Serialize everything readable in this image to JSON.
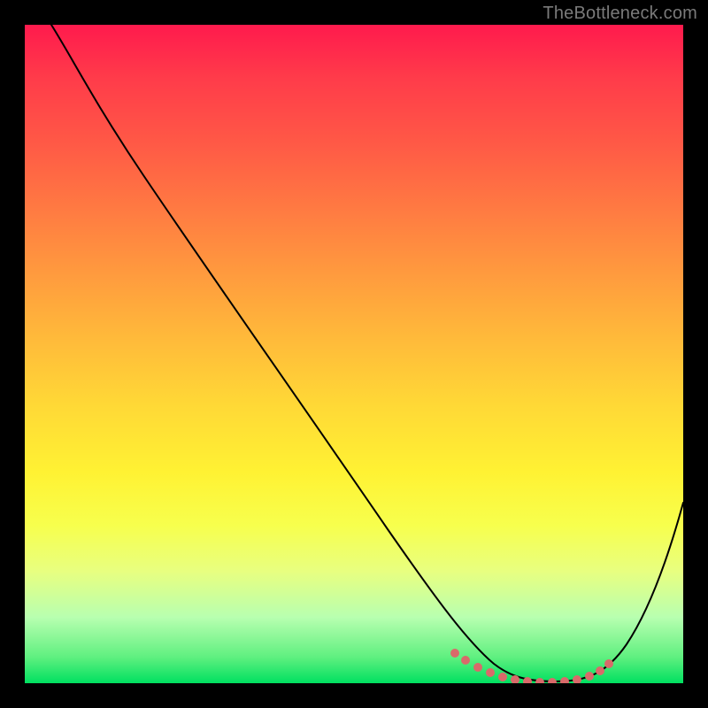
{
  "watermark": "TheBottleneck.com",
  "chart_data": {
    "type": "line",
    "title": "",
    "xlabel": "",
    "ylabel": "",
    "xlim": [
      0,
      100
    ],
    "ylim": [
      0,
      100
    ],
    "grid": false,
    "series": [
      {
        "name": "bottleneck-curve",
        "x": [
          4,
          10,
          18,
          26,
          34,
          42,
          50,
          58,
          63,
          66,
          70,
          74,
          78,
          82,
          86,
          90,
          95,
          100
        ],
        "y": [
          100,
          93,
          83,
          72,
          61,
          50,
          39,
          27,
          19,
          13,
          7,
          3,
          1,
          0,
          0,
          3,
          13,
          28
        ]
      }
    ],
    "highlight_points": {
      "name": "bottom-dots",
      "x": [
        64,
        67,
        69,
        72,
        74,
        76,
        78,
        80,
        82,
        84,
        86,
        88
      ],
      "y": [
        3,
        2,
        1.5,
        1,
        0.8,
        0.6,
        0.5,
        0.5,
        0.5,
        0.6,
        1.2,
        2.5
      ]
    },
    "background_gradient": {
      "stops": [
        "#ff1a4d",
        "#ff7a42",
        "#ffd936",
        "#f7ff4d",
        "#00e060"
      ],
      "direction": "top-to-bottom"
    }
  }
}
